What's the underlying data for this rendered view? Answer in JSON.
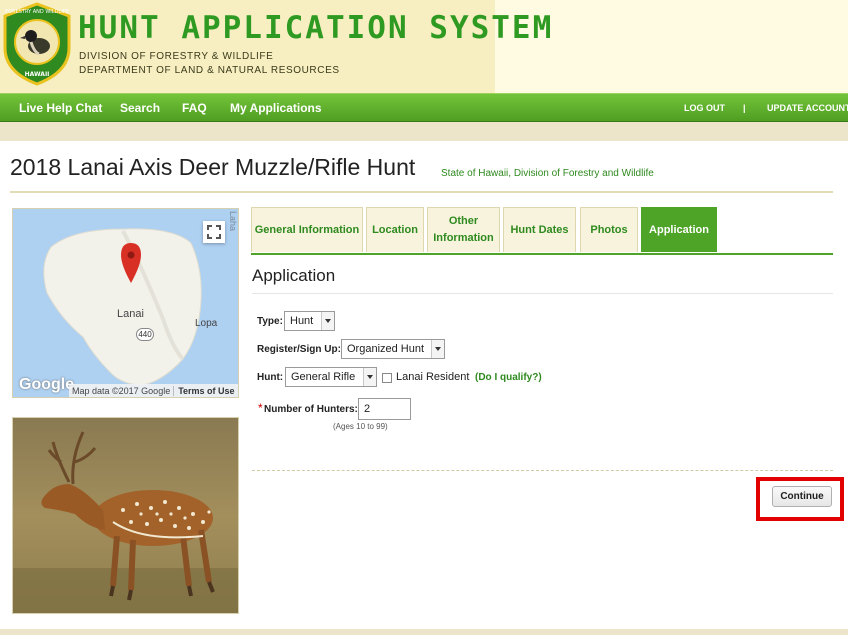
{
  "header": {
    "title": "HUNT APPLICATION SYSTEM",
    "division": "DIVISION OF FORESTRY & WILDLIFE",
    "department": "DEPARTMENT OF LAND & NATURAL RESOURCES",
    "seal_text_top": "FORESTRY AND WILDLIFE",
    "seal_text_bottom": "HAWAII"
  },
  "nav": {
    "live_help": "Live Help Chat",
    "search": "Search",
    "faq": "FAQ",
    "my_applications": "My Applications",
    "logout": "LOG OUT",
    "separator": "|",
    "update_account": "UPDATE ACCOUNT"
  },
  "page": {
    "title": "2018 Lanai Axis Deer Muzzle/Rifle Hunt",
    "agency": "State of Hawaii, Division of Forestry and Wildlife"
  },
  "map": {
    "place_lanai": "Lanai",
    "place_lopa": "Lopa",
    "place_edge": "Laha",
    "road_number": "440",
    "brand": "Google",
    "attribution": "Map data ©2017 Google",
    "terms": "Terms of Use"
  },
  "tabs": [
    {
      "label": "General Information"
    },
    {
      "label": "Location"
    },
    {
      "label_line1": "Other",
      "label_line2": "Information"
    },
    {
      "label": "Hunt Dates"
    },
    {
      "label": "Photos"
    },
    {
      "label": "Application",
      "active": true
    }
  ],
  "application": {
    "heading": "Application",
    "type_label": "Type:",
    "type_value": "Hunt",
    "register_label": "Register/Sign Up:",
    "register_value": "Organized Hunt",
    "hunt_label": "Hunt:",
    "hunt_value": "General Rifle",
    "resident_label": "Lanai Resident",
    "resident_checked": false,
    "qualify_link": "(Do I qualify?)",
    "required_marker": "*",
    "hunters_label": "Number of Hunters:",
    "hunters_value": "2",
    "ages_note": "(Ages 10 to 99)",
    "continue_label": "Continue"
  },
  "colors": {
    "brand_green": "#2f9a22",
    "nav_green": "#5aad2b",
    "active_tab": "#4ea427",
    "highlight_red": "#e20000"
  }
}
